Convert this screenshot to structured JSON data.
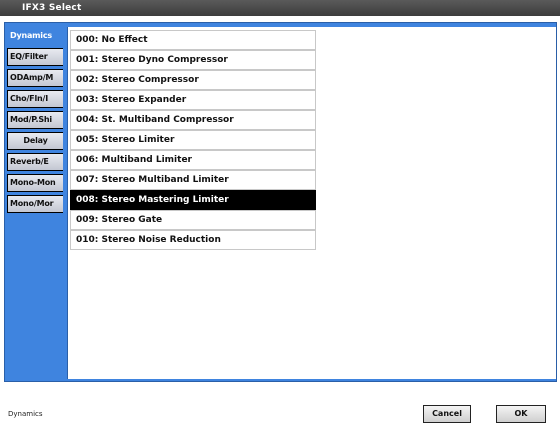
{
  "window": {
    "title": "IFX3 Select"
  },
  "tabs": [
    {
      "label": "Dynamics",
      "active": true
    },
    {
      "label": "EQ/Filter"
    },
    {
      "label": "ODAmp/M"
    },
    {
      "label": "Cho/Fln/I"
    },
    {
      "label": "Mod/P.Shi"
    },
    {
      "label": "Delay"
    },
    {
      "label": "Reverb/E"
    },
    {
      "label": "Mono-Mon"
    },
    {
      "label": "Mono/Mor"
    }
  ],
  "effects": [
    "000: No Effect",
    "001: Stereo Dyno Compressor",
    "002: Stereo Compressor",
    "003: Stereo Expander",
    "004: St. Multiband Compressor",
    "005: Stereo Limiter",
    "006: Multiband Limiter",
    "007: Stereo Multiband Limiter",
    "008: Stereo Mastering Limiter",
    "009: Stereo Gate",
    "010: Stereo Noise Reduction"
  ],
  "selected_effect": "008: Stereo Mastering Limiter",
  "status": {
    "category": "Dynamics"
  },
  "buttons": {
    "cancel": "Cancel",
    "ok": "OK"
  },
  "colors": {
    "panel": "#3f84df",
    "titlebar": "#4a4a4a",
    "selection": "#000000"
  }
}
